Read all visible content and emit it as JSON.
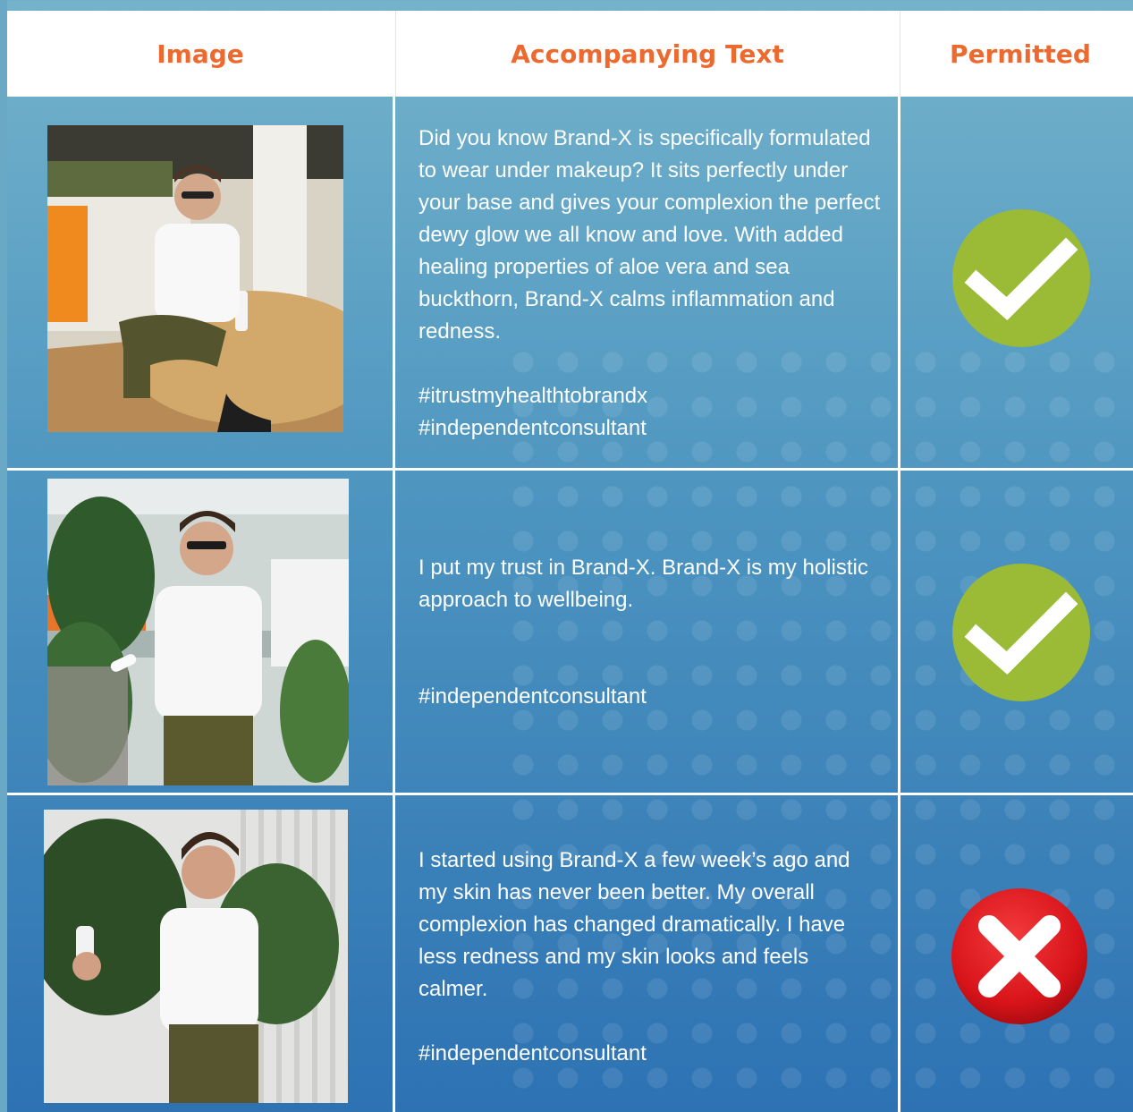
{
  "headers": {
    "image": "Image",
    "text": "Accompanying Text",
    "permitted": "Permitted"
  },
  "rows": [
    {
      "image_alt": "Man in white t-shirt seated at a round wooden table in an office, product bottle on table",
      "body": "Did you know Brand-X is specifically formulated to wear under makeup? It sits perfectly under your base and gives your complexion the perfect dewy glow we all know and love. With added healing properties of aloe vera and sea buckthorn, Brand-X calms inflammation and redness.",
      "tags": "#itrustmyhealthtobrandx #independentconsultant",
      "permitted": true,
      "icon": "check-icon"
    },
    {
      "image_alt": "Man in white t-shirt and glasses holding a product tube among office plants",
      "body": "I put my trust in Brand-X. Brand-X is my holistic approach to wellbeing.",
      "tags": "#independentconsultant",
      "permitted": true,
      "icon": "check-icon"
    },
    {
      "image_alt": "Man in white t-shirt spraying product, standing in front of plants and a white wall",
      "body": "I started using Brand-X a few week’s ago and my skin has never been better. My overall complexion has changed dramatically. I have less redness and my skin looks and feels calmer.",
      "tags": "#independentconsultant",
      "permitted": false,
      "icon": "cross-icon"
    }
  ],
  "colors": {
    "header_text": "#ec6a2f",
    "check_green": "#9bbb36",
    "cross_red": "#d8141a"
  }
}
